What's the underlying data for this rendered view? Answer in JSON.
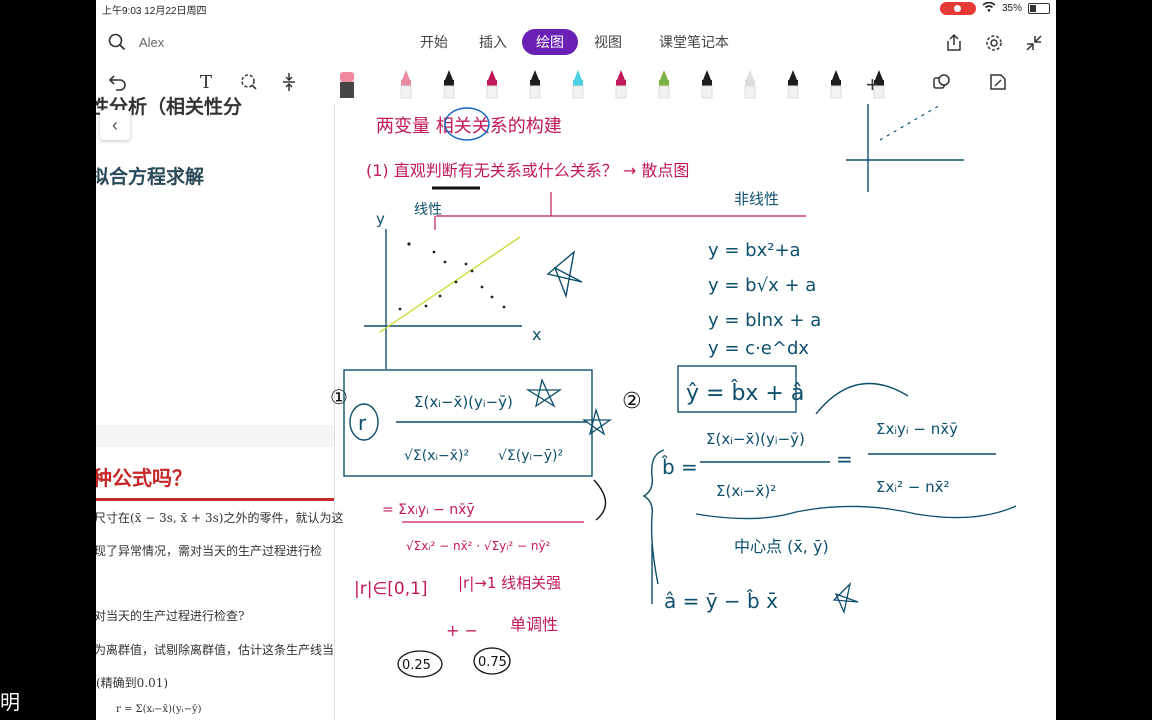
{
  "status": {
    "time_date": "上午9:03   12月22日周四",
    "battery": "35%"
  },
  "header": {
    "search_label": "Alex",
    "tabs": [
      {
        "label": "开始"
      },
      {
        "label": "插入"
      },
      {
        "label": "绘图",
        "active": true
      },
      {
        "label": "视图"
      },
      {
        "label": "课堂笔记本"
      }
    ]
  },
  "toolbar": {
    "text_tool": "T",
    "pens": [
      "#e88aa0",
      "#1e1e1e",
      "#c2185b",
      "#1e1e1e",
      "#4dd0e1",
      "#c2185b",
      "#7cb342",
      "#1e1e1e",
      "#dddddd",
      "#1e1e1e",
      "#1e1e1e",
      "#1e1e1e"
    ]
  },
  "doc": {
    "heading1": "性分析（相关性分",
    "heading2": "拟合方程求解",
    "question_title": "种公式吗？",
    "lines": [
      "尺寸在(x̄ − 3s, x̄ + 3s)之外的零件，就认为这",
      "现了异常情况，需对当天的生产过程进行检",
      "对当天的生产过程进行检查?",
      "为离群值，试剔除离群值，估计这条生产线当",
      "(精确到0.01)"
    ],
    "bottom_formula": "r = Σ(xᵢ−x̄)(yᵢ−ȳ)"
  },
  "notes": {
    "title": "两变量 相关关系的构建",
    "line1": "(1) 直观判断有无关系或什么关系？ → 散点图",
    "linear": "线性",
    "nonlinear": "非线性",
    "eq1": "y = bx²+a",
    "eq2": "y = b√x + a",
    "eq3": "y = blnx + a",
    "eq4": "y = c·e^dx",
    "axis_y": "y",
    "axis_x": "x",
    "circle1": "①",
    "r_label": "r",
    "r_num": "Σ(xᵢ−x̄)(yᵢ−ȳ)",
    "r_den1": "√Σ(xᵢ−x̄)²",
    "r_den2": "√Σ(yᵢ−ȳ)²",
    "r_alt_num": "= Σxᵢyᵢ − nx̄ȳ",
    "r_alt_den": "√Σxᵢ² − nx̄² · √Σyᵢ² − nȳ²",
    "r_range": "|r|∈[0,1]",
    "r_strong": "|r|→1 线相关强",
    "sign": "+ −",
    "monotonic": "单调性",
    "val1": "0.25",
    "val2": "0.75",
    "circle2": "②",
    "reg": "ŷ = b̂x + â",
    "b_hat": "b̂ =",
    "b_num": "Σ(xᵢ−x̄)(yᵢ−ȳ)",
    "b_den": "Σ(xᵢ−x̄)²",
    "b_alt_num": "Σxᵢyᵢ − nx̄ȳ",
    "b_alt_den": "Σxᵢ² − nx̄²",
    "eq_sign": "=",
    "center": "中心点 (x̄, ȳ)",
    "a_hat": "â = ȳ − b̂ x̄"
  }
}
